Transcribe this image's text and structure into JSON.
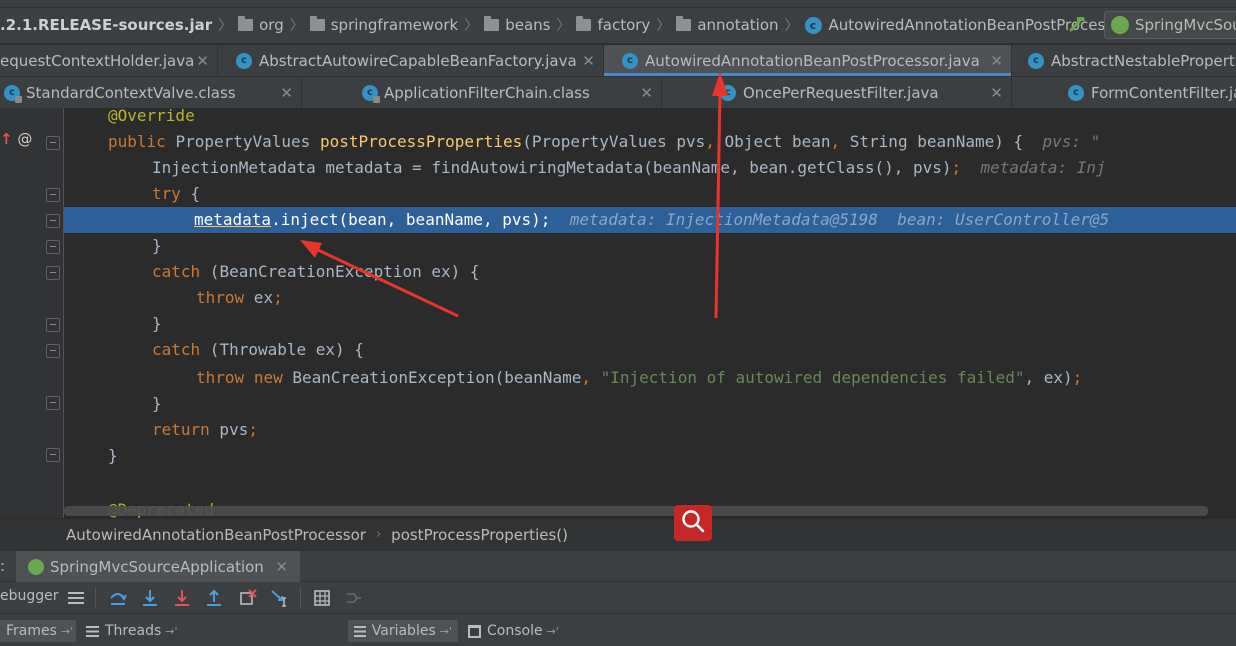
{
  "breadcrumb": {
    "items": [
      {
        "label": ".2.1.RELEASE-sources.jar",
        "kind": "jar"
      },
      {
        "label": "org",
        "kind": "folder"
      },
      {
        "label": "springframework",
        "kind": "folder"
      },
      {
        "label": "beans",
        "kind": "folder"
      },
      {
        "label": "factory",
        "kind": "folder"
      },
      {
        "label": "annotation",
        "kind": "folder"
      },
      {
        "label": "AutowiredAnnotationBeanPostProcessor",
        "kind": "class"
      }
    ],
    "build_icon": "hammer-icon",
    "run_config": "SpringMvcSou"
  },
  "tabs_row1": [
    {
      "label": "equestContextHolder.java",
      "active": false
    },
    {
      "label": "AbstractAutowireCapableBeanFactory.java",
      "active": false
    },
    {
      "label": "AutowiredAnnotationBeanPostProcessor.java",
      "active": true
    },
    {
      "label": "AbstractNestablePropert",
      "active": false
    }
  ],
  "tabs_row2": [
    {
      "label": "StandardContextValve.class"
    },
    {
      "label": "ApplicationFilterChain.class"
    },
    {
      "label": "OncePerRequestFilter.java"
    },
    {
      "label": "FormContentFilter.ja"
    }
  ],
  "code": {
    "l1": {
      "annotation": "@Override"
    },
    "l2": {
      "kw1": "public",
      "type": "PropertyValues",
      "method": "postProcessProperties",
      "params_a": "(PropertyValues pvs",
      "comma1": ",",
      "params_b": " Object bean",
      "comma2": ",",
      "params_c": " String beanName) {",
      "hint": "pvs: \""
    },
    "l3": {
      "text": "InjectionMetadata metadata = findAutowiringMetadata(beanName, bean.getClass(), pvs)",
      "semi": ";",
      "hint": "metadata: Inj"
    },
    "l4": {
      "kw": "try",
      "rest": " {"
    },
    "l5": {
      "var": "metadata",
      "rest": ".inject(bean, beanName, pvs)",
      "semi": ";",
      "hint": "metadata: InjectionMetadata@5198  bean: UserController@5"
    },
    "l6": {
      "text": "}"
    },
    "l7": {
      "kw": "catch",
      "rest": " (BeanCreationException ex) {"
    },
    "l8": {
      "kw": "throw",
      "rest": " ex",
      "semi": ";"
    },
    "l9": {
      "text": "}"
    },
    "l10": {
      "kw": "catch",
      "rest": " (Throwable ex) {"
    },
    "l11": {
      "kw1": "throw",
      "kw2": "new",
      "rest_a": " BeanCreationException(beanName",
      "comma": ",",
      "str": "\"Injection of autowired dependencies failed\"",
      "rest_b": ", ex)",
      "semi": ";"
    },
    "l12": {
      "text": "}"
    },
    "l13": {
      "kw": "return",
      "rest": " pvs",
      "semi": ";"
    },
    "l14": {
      "text": "}"
    },
    "l16": {
      "annotation": "@Deprecated"
    }
  },
  "gutter": {
    "override_marker": "@"
  },
  "editor_breadcrumb": {
    "class_name": "AutowiredAnnotationBeanPostProcessor",
    "method_name": "postProcessProperties()"
  },
  "search_button_icon": "search-icon",
  "debug": {
    "prefix": ":",
    "session_tab": "SpringMvcSourceApplication",
    "toolbar_label": "ebugger",
    "bottom_tabs": [
      {
        "label": "Frames"
      },
      {
        "label": "Threads"
      },
      {
        "label": "Variables"
      },
      {
        "label": "Console"
      }
    ]
  },
  "colors": {
    "accent": "#4a88c7",
    "highlight_line": "#2d6099",
    "keyword": "#cc7832",
    "annotation": "#bbb529",
    "method": "#ffc66d",
    "string": "#6a8759",
    "arrow": "#e8342a"
  }
}
